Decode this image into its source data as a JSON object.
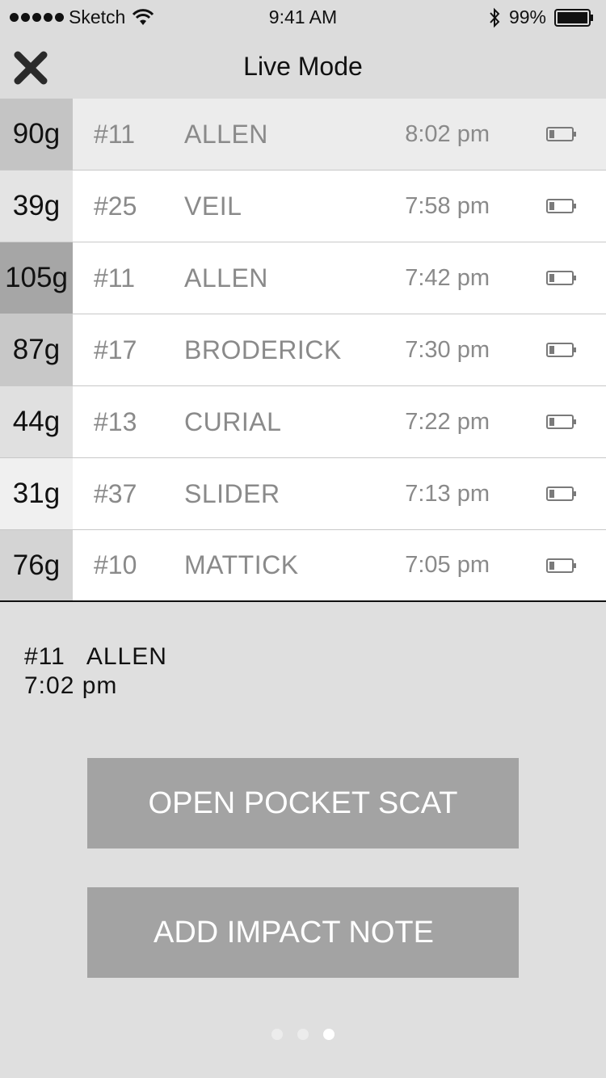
{
  "status_bar": {
    "carrier": "Sketch",
    "time": "9:41 AM",
    "battery": "99%"
  },
  "nav": {
    "title": "Live Mode",
    "close_icon": "close-icon"
  },
  "impacts": [
    {
      "g": "90g",
      "number": "#11",
      "name": "ALLEN",
      "time": "8:02 pm",
      "g_color": "#c4c4c4",
      "selected": true
    },
    {
      "g": "39g",
      "number": "#25",
      "name": "VEIL",
      "time": "7:58 pm",
      "g_color": "#e4e4e4",
      "selected": false
    },
    {
      "g": "105g",
      "number": "#11",
      "name": "ALLEN",
      "time": "7:42 pm",
      "g_color": "#a6a6a6",
      "selected": false
    },
    {
      "g": "87g",
      "number": "#17",
      "name": "BRODERICK",
      "time": "7:30 pm",
      "g_color": "#c8c8c8",
      "selected": false
    },
    {
      "g": "44g",
      "number": "#13",
      "name": "CURIAL",
      "time": "7:22 pm",
      "g_color": "#e0e0e0",
      "selected": false
    },
    {
      "g": "31g",
      "number": "#37",
      "name": "SLIDER",
      "time": "7:13 pm",
      "g_color": "#f0f0f0",
      "selected": false
    },
    {
      "g": "76g",
      "number": "#10",
      "name": "MATTICK",
      "time": "7:05 pm",
      "g_color": "#d4d4d4",
      "selected": false
    }
  ],
  "detail": {
    "number": "#11",
    "name": "ALLEN",
    "time": "7:02 pm"
  },
  "buttons": {
    "open_pocket_scat": "OPEN POCKET SCAT",
    "add_impact_note": "ADD IMPACT NOTE"
  },
  "pager": {
    "count": 3,
    "active_index": 2
  }
}
